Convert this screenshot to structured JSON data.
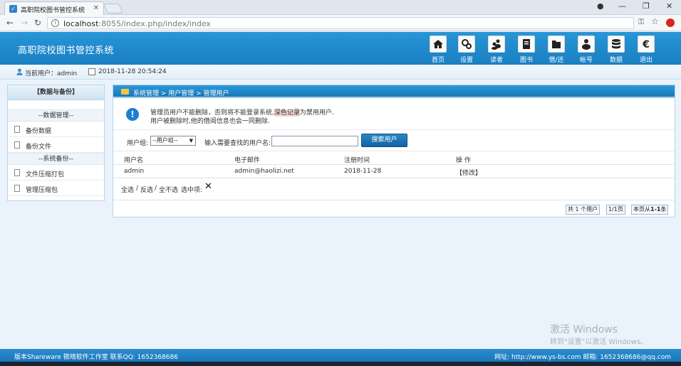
{
  "browser": {
    "tab_title": "高职院校图书管控系统",
    "url_host": "localhost",
    "url_rest": ":8055/index.php/index/index"
  },
  "app": {
    "title": "高职院校图书管控系统",
    "nav": [
      {
        "label": "首页",
        "icon": "home-icon"
      },
      {
        "label": "设置",
        "icon": "settings-icon"
      },
      {
        "label": "读者",
        "icon": "readers-icon"
      },
      {
        "label": "图书",
        "icon": "book-icon"
      },
      {
        "label": "借/还",
        "icon": "borrow-return-icon"
      },
      {
        "label": "帐号",
        "icon": "account-icon"
      },
      {
        "label": "数据",
        "icon": "database-icon"
      },
      {
        "label": "退出",
        "icon": "exit-icon"
      }
    ]
  },
  "userbar": {
    "current_user": "当前用户：admin",
    "datetime": "2018-11-28 20:54:24"
  },
  "sidebar": {
    "title": "【数据与备份】",
    "group1": "--数据管理--",
    "group1_items": [
      "备份数据",
      "备份文件"
    ],
    "group2": "--系统备份--",
    "group2_items": [
      "文件压缩打包",
      "管理压缩包"
    ]
  },
  "main": {
    "breadcrumb": "系统管理 > 用户管理 > 管理用户",
    "notice_line1_a": "管理员用户不能删除，否则将不能登录系统,",
    "notice_line1_hl": "深色记录",
    "notice_line1_b": "为禁用用户.",
    "notice_line2": "用户被删除时,他的借阅信息也会一同删除.",
    "filter": {
      "group_label": "用户组:",
      "group_value": "--用户组--",
      "search_label": "输入需要查找的用户名:",
      "search_value": "",
      "search_button": "搜索用户"
    },
    "table": {
      "headers": [
        "用户名",
        "电子邮件",
        "注册时间",
        "操 作"
      ],
      "rows": [
        {
          "username": "admin",
          "email": "admin@haolizi.net",
          "registered": "2018-11-28",
          "action": "【修改】"
        }
      ]
    },
    "bulk": {
      "select_all": "全选",
      "sep1": "/",
      "invert": "反选",
      "sep2": "/",
      "select_none": "全不选",
      "selected_label": "选中项:"
    },
    "pager": {
      "total": "共 1 个用户",
      "page": "1/1页",
      "range_prefix": "本页从",
      "range_bold": "1-1",
      "range_suffix": "条"
    }
  },
  "watermark": {
    "line1": "激活 Windows",
    "line2": "转到\"设置\"以激活 Windows。"
  },
  "footer": {
    "left": "版本Shareware  筱晴软件工作室  联系QQ: 1652368686",
    "right": "网址:  http://www.ys-bs.com  邮箱: 1652368686@qq.com"
  }
}
